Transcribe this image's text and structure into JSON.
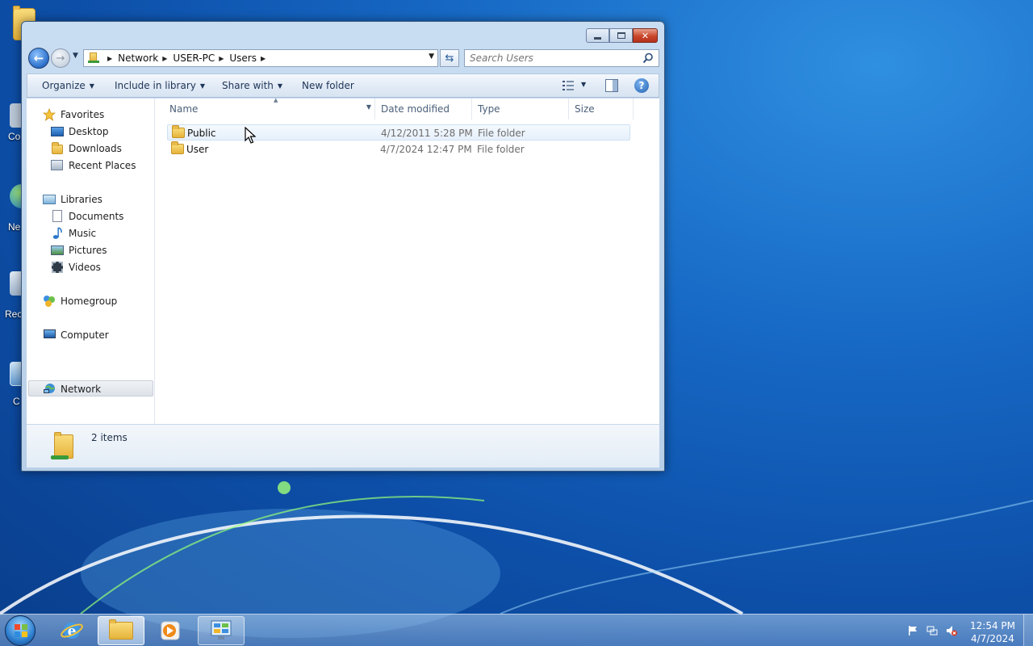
{
  "desktop": {
    "icons": [
      {
        "label": "Co"
      },
      {
        "label": "Ne"
      },
      {
        "label": "Rec"
      },
      {
        "label": "C"
      }
    ]
  },
  "window": {
    "address": {
      "crumbs": [
        "Network",
        "USER-PC",
        "Users"
      ]
    },
    "search": {
      "placeholder": "Search Users"
    },
    "commands": {
      "organize": "Organize",
      "include_in_library": "Include in library",
      "share_with": "Share with",
      "new_folder": "New folder"
    },
    "nav_pane": {
      "favorites": "Favorites",
      "desktop": "Desktop",
      "downloads": "Downloads",
      "recent_places": "Recent Places",
      "libraries": "Libraries",
      "documents": "Documents",
      "music": "Music",
      "pictures": "Pictures",
      "videos": "Videos",
      "homegroup": "Homegroup",
      "computer": "Computer",
      "network": "Network"
    },
    "columns": {
      "name": "Name",
      "date_modified": "Date modified",
      "type": "Type",
      "size": "Size"
    },
    "files": [
      {
        "name": "Public",
        "date": "4/12/2011 5:28 PM",
        "type": "File folder",
        "size": ""
      },
      {
        "name": "User",
        "date": "4/7/2024 12:47 PM",
        "type": "File folder",
        "size": ""
      }
    ],
    "details": {
      "count": "2 items"
    }
  },
  "taskbar": {
    "clock": {
      "time": "12:54 PM",
      "date": "4/7/2024"
    }
  },
  "colors": {
    "accent": "#2a6fc9",
    "selection": "#e6f0fb",
    "desktop": "#1668c4"
  }
}
